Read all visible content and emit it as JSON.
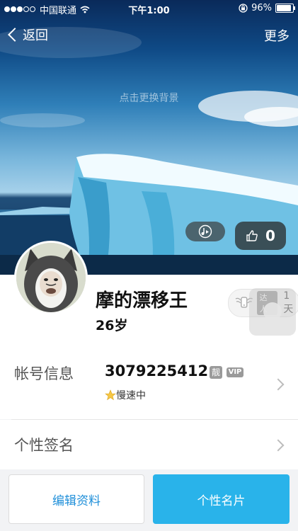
{
  "status_bar": {
    "carrier": "中国联通",
    "time": "下午1:00",
    "battery": "96%",
    "signal_dots_filled": 3,
    "signal_dots_total": 5
  },
  "nav": {
    "back_label": "返回",
    "more_label": "更多"
  },
  "cover": {
    "change_background_hint": "点击更换背景"
  },
  "likes": {
    "count": "0"
  },
  "profile": {
    "nickname": "摩的漂移王",
    "age": "26岁",
    "daren_tag": "达人",
    "daren_days": "1天"
  },
  "account_info": {
    "label": "帐号信息",
    "qq_number": "3079225412",
    "liang_badge": "靓",
    "vip_badge": "VIP",
    "speed_status": "慢速中"
  },
  "signature": {
    "label": "个性签名"
  },
  "bottom": {
    "edit_label": "编辑资料",
    "card_label": "个性名片"
  },
  "colors": {
    "accent_blue": "#29b3ea",
    "link_blue": "#1f8fd9",
    "background": "#f2f3f5"
  },
  "icons": [
    "wifi-icon",
    "lock-rotation-icon",
    "battery-icon",
    "back-chevron-icon",
    "music-icon",
    "thumbs-up-icon",
    "star-icon",
    "chevron-right-icon",
    "daren-wings-icon"
  ]
}
